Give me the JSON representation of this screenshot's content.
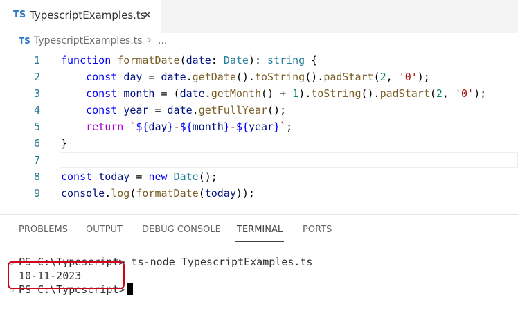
{
  "tab": {
    "badge": "TS",
    "title": "TypescriptExamples.ts",
    "close": "✕"
  },
  "breadcrumb": {
    "badge": "TS",
    "file": "TypescriptExamples.ts",
    "sep": "›",
    "more": "..."
  },
  "editor": {
    "line_numbers": [
      "1",
      "2",
      "3",
      "4",
      "5",
      "6",
      "7",
      "8",
      "9"
    ],
    "lines": [
      [
        [
          "kw",
          "function "
        ],
        [
          "fn",
          "formatDate"
        ],
        [
          "",
          "("
        ],
        [
          "var",
          "date"
        ],
        [
          "",
          ": "
        ],
        [
          "ty",
          "Date"
        ],
        [
          "",
          "): "
        ],
        [
          "ty",
          "string"
        ],
        [
          "",
          " {"
        ]
      ],
      [
        [
          "",
          "    "
        ],
        [
          "kw",
          "const "
        ],
        [
          "var",
          "day"
        ],
        [
          "",
          " = "
        ],
        [
          "var",
          "date"
        ],
        [
          "",
          "."
        ],
        [
          "fn",
          "getDate"
        ],
        [
          "",
          "()."
        ],
        [
          "fn",
          "toString"
        ],
        [
          "",
          "()."
        ],
        [
          "fn",
          "padStart"
        ],
        [
          "",
          "("
        ],
        [
          "num",
          "2"
        ],
        [
          "",
          ", "
        ],
        [
          "str",
          "'0'"
        ],
        [
          "",
          ");"
        ]
      ],
      [
        [
          "",
          "    "
        ],
        [
          "kw",
          "const "
        ],
        [
          "var",
          "month"
        ],
        [
          "",
          " = ("
        ],
        [
          "var",
          "date"
        ],
        [
          "",
          "."
        ],
        [
          "fn",
          "getMonth"
        ],
        [
          "",
          "() + "
        ],
        [
          "num",
          "1"
        ],
        [
          "",
          ")."
        ],
        [
          "fn",
          "toString"
        ],
        [
          "",
          "()."
        ],
        [
          "fn",
          "padStart"
        ],
        [
          "",
          "("
        ],
        [
          "num",
          "2"
        ],
        [
          "",
          ", "
        ],
        [
          "str",
          "'0'"
        ],
        [
          "",
          ");"
        ]
      ],
      [
        [
          "",
          "    "
        ],
        [
          "kw",
          "const "
        ],
        [
          "var",
          "year"
        ],
        [
          "",
          " = "
        ],
        [
          "var",
          "date"
        ],
        [
          "",
          "."
        ],
        [
          "fn",
          "getFullYear"
        ],
        [
          "",
          "();"
        ]
      ],
      [
        [
          "",
          "    "
        ],
        [
          "ctl",
          "return "
        ],
        [
          "str",
          "`"
        ],
        [
          "kw",
          "${"
        ],
        [
          "var",
          "day"
        ],
        [
          "kw",
          "}"
        ],
        [
          "str",
          "-"
        ],
        [
          "kw",
          "${"
        ],
        [
          "var",
          "month"
        ],
        [
          "kw",
          "}"
        ],
        [
          "str",
          "-"
        ],
        [
          "kw",
          "${"
        ],
        [
          "var",
          "year"
        ],
        [
          "kw",
          "}"
        ],
        [
          "str",
          "`"
        ],
        [
          "",
          ";"
        ]
      ],
      [
        [
          "",
          "}"
        ]
      ],
      [],
      [
        [
          "kw",
          "const "
        ],
        [
          "var",
          "today"
        ],
        [
          "",
          " = "
        ],
        [
          "kw",
          "new "
        ],
        [
          "ty",
          "Date"
        ],
        [
          "",
          "();"
        ]
      ],
      [
        [
          "var",
          "console"
        ],
        [
          "",
          "."
        ],
        [
          "fn",
          "log"
        ],
        [
          "",
          "("
        ],
        [
          "fn",
          "formatDate"
        ],
        [
          "",
          "("
        ],
        [
          "var",
          "today"
        ],
        [
          "",
          "));"
        ]
      ]
    ]
  },
  "panel": {
    "tabs": [
      "PROBLEMS",
      "OUTPUT",
      "DEBUG CONSOLE",
      "TERMINAL",
      "PORTS"
    ],
    "active": "TERMINAL"
  },
  "terminal": {
    "line1_prompt": "PS C:\\Typescript>",
    "line1_cmd": " ts-node TypescriptExamples.ts",
    "output": "10-11-2023",
    "line3_prompt": "PS C:\\Typescript>"
  },
  "colors": {
    "highlight_box": "#d0021b",
    "ts_badge": "#3178c6"
  }
}
